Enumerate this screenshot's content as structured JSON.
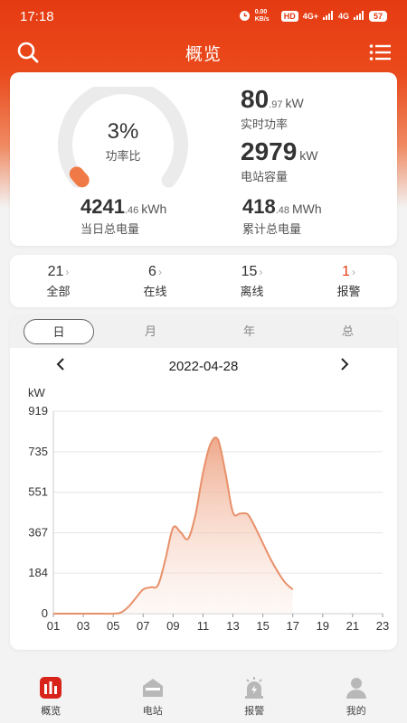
{
  "status_bar": {
    "time": "17:18",
    "net_speed": "0.00 KB/s",
    "hd_label": "HD",
    "signal_1": "4G+",
    "signal_2": "4G",
    "battery": "57"
  },
  "header": {
    "title": "概览",
    "search_icon": "search-icon",
    "menu_icon": "menu-icon",
    "accent_color": "#e63a12"
  },
  "summary": {
    "gauge_percent": "3%",
    "gauge_label": "功率比",
    "gauge_value": 0.03,
    "realtime_power_int": "80",
    "realtime_power_dec": ".97",
    "realtime_power_unit": "kW",
    "realtime_power_label": "实时功率",
    "capacity_int": "2979",
    "capacity_unit": "kW",
    "capacity_label": "电站容量",
    "daily_energy_int": "4241",
    "daily_energy_dec": ".46",
    "daily_energy_unit": "kWh",
    "daily_energy_label": "当日总电量",
    "total_energy_int": "418",
    "total_energy_dec": ".48",
    "total_energy_unit": "MWh",
    "total_energy_label": "累计总电量"
  },
  "counts": [
    {
      "num": "21",
      "label": "全部",
      "alarm": false
    },
    {
      "num": "6",
      "label": "在线",
      "alarm": false
    },
    {
      "num": "15",
      "label": "离线",
      "alarm": false
    },
    {
      "num": "1",
      "label": "报警",
      "alarm": true
    }
  ],
  "chart_tabs": {
    "day": "日",
    "month": "月",
    "year": "年",
    "total": "总"
  },
  "date_nav": {
    "date": "2022-04-28",
    "prev_icon": "chevron-left-icon",
    "next_icon": "chevron-right-icon"
  },
  "chart_data": {
    "type": "area",
    "ylabel": "kW",
    "ylim": [
      0,
      919
    ],
    "yticks": [
      "0",
      "184",
      "367",
      "551",
      "735",
      "919"
    ],
    "xticks": [
      "01",
      "03",
      "05",
      "07",
      "09",
      "11",
      "13",
      "15",
      "17",
      "19",
      "21",
      "23"
    ],
    "xlim": [
      1,
      23
    ],
    "grid": true,
    "series": [
      {
        "color": "#e8906a",
        "x": [
          1,
          2,
          3,
          4,
          5,
          5.5,
          6,
          6.5,
          7,
          7.5,
          8,
          8.5,
          9,
          9.5,
          10,
          10.5,
          11,
          11.5,
          12,
          12.5,
          13,
          13.5,
          14,
          14.5,
          15,
          15.5,
          16,
          16.5,
          17
        ],
        "y": [
          0,
          0,
          0,
          0,
          0,
          5,
          30,
          70,
          110,
          120,
          130,
          250,
          390,
          370,
          340,
          450,
          640,
          770,
          790,
          640,
          460,
          455,
          450,
          390,
          320,
          250,
          190,
          140,
          110
        ]
      }
    ]
  },
  "tabbar": [
    {
      "label": "概览",
      "icon": "overview-chart-icon",
      "active": true
    },
    {
      "label": "电站",
      "icon": "station-icon",
      "active": false
    },
    {
      "label": "报警",
      "icon": "alarm-icon",
      "active": false
    },
    {
      "label": "我的",
      "icon": "profile-icon",
      "active": false
    }
  ]
}
